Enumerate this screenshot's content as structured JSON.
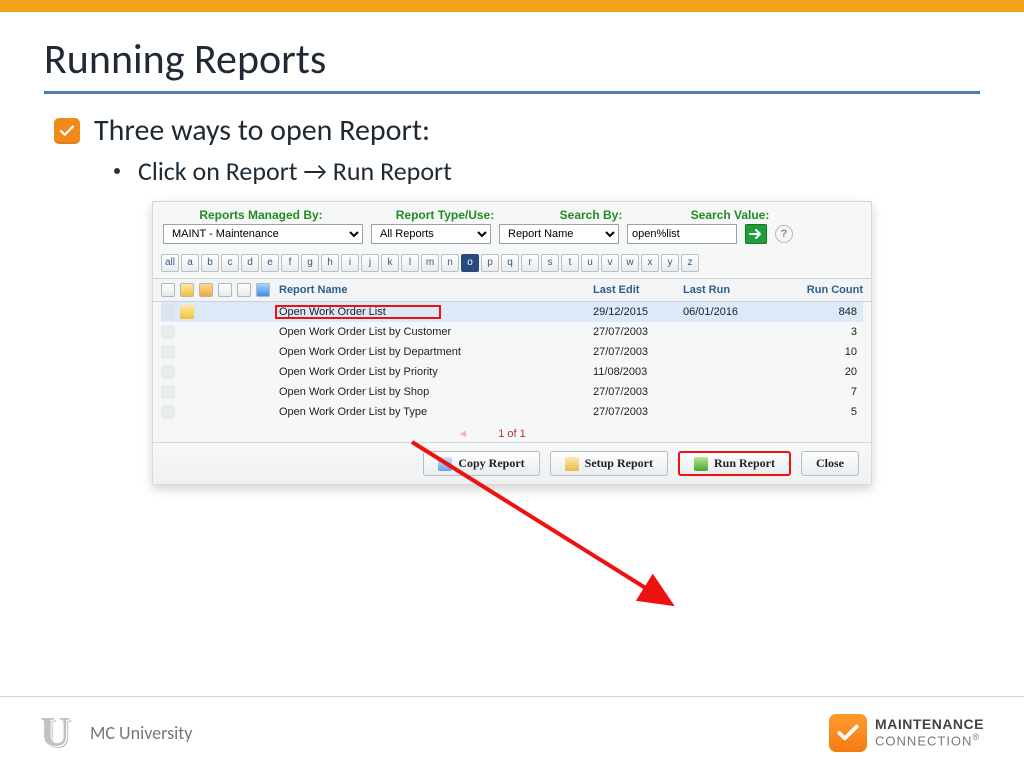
{
  "slide": {
    "title": "Running Reports",
    "bullet": "Three ways to open Report:",
    "subbullet": "Click on Report → Run Report"
  },
  "filters": {
    "labels": {
      "managed": "Reports Managed By:",
      "type": "Report Type/Use:",
      "searchby": "Search By:",
      "searchval": "Search Value:"
    },
    "managed": "MAINT - Maintenance",
    "type": "All Reports",
    "searchby": "Report Name",
    "searchval": "open%list"
  },
  "alpha": {
    "letters": [
      "all",
      "a",
      "b",
      "c",
      "d",
      "e",
      "f",
      "g",
      "h",
      "i",
      "j",
      "k",
      "l",
      "m",
      "n",
      "o",
      "p",
      "q",
      "r",
      "s",
      "t",
      "u",
      "v",
      "w",
      "x",
      "y",
      "z"
    ],
    "active": "o"
  },
  "columns": {
    "name": "Report Name",
    "edit": "Last Edit",
    "run": "Last Run",
    "count": "Run Count"
  },
  "rows": [
    {
      "name": "Open Work Order List",
      "edit": "29/12/2015",
      "run": "06/01/2016",
      "count": 848,
      "selected": true
    },
    {
      "name": "Open Work Order List by Customer",
      "edit": "27/07/2003",
      "run": "",
      "count": 3
    },
    {
      "name": "Open Work Order List by Department",
      "edit": "27/07/2003",
      "run": "",
      "count": 10
    },
    {
      "name": "Open Work Order List by Priority",
      "edit": "11/08/2003",
      "run": "",
      "count": 20
    },
    {
      "name": "Open Work Order List by Shop",
      "edit": "27/07/2003",
      "run": "",
      "count": 7
    },
    {
      "name": "Open Work Order List by Type",
      "edit": "27/07/2003",
      "run": "",
      "count": 5
    }
  ],
  "pager": "1 of 1",
  "buttons": {
    "copy": "Copy Report",
    "setup": "Setup Report",
    "run": "Run Report",
    "close": "Close"
  },
  "footer": {
    "university": "MC University",
    "brand1": "MAINTENANCE",
    "brand2": "CONNECTION"
  }
}
